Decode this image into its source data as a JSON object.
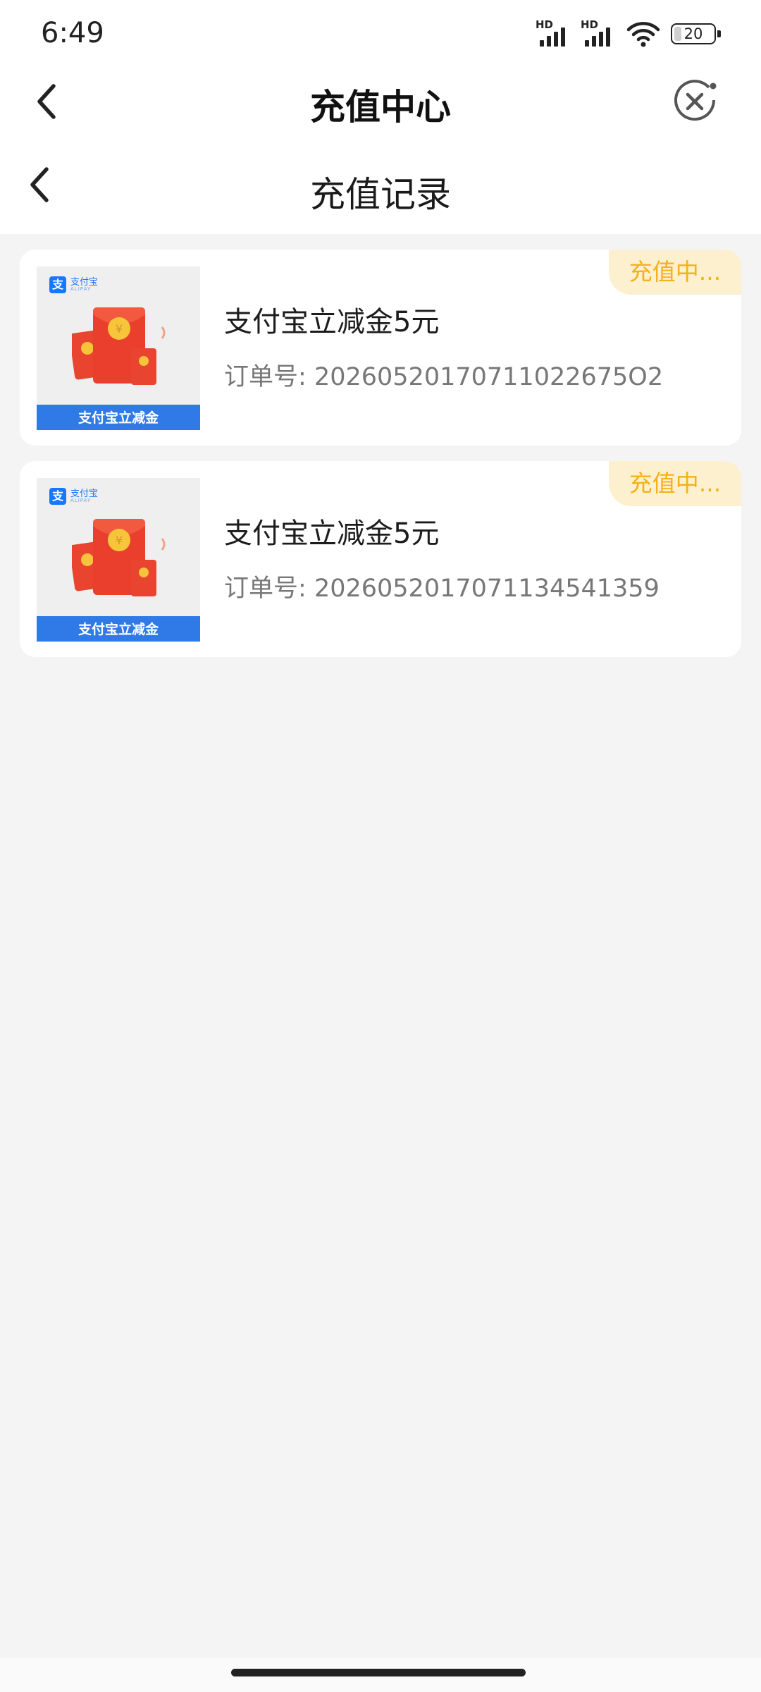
{
  "status_bar": {
    "time": "6:49",
    "signal_label": "HD",
    "battery_level": "20",
    "icons": [
      "hd-signal-icon",
      "hd-signal-icon",
      "wifi-icon",
      "battery-icon"
    ]
  },
  "header": {
    "title": "充值中心",
    "back_icon": "chevron-left-icon",
    "close_icon": "circle-close-icon"
  },
  "subheader": {
    "title": "充值记录",
    "back_icon": "chevron-left-icon"
  },
  "orders": [
    {
      "status": "充值中...",
      "product_name": "支付宝立减金5元",
      "order_label": "订单号:",
      "order_number": "20260520170711022675O2",
      "thumb": {
        "brand": "支付宝",
        "brand_sub": "ALIPAY",
        "banner": "支付宝立减金"
      }
    },
    {
      "status": "充值中...",
      "product_name": "支付宝立减金5元",
      "order_label": "订单号:",
      "order_number": "2026052017071134541359",
      "thumb": {
        "brand": "支付宝",
        "brand_sub": "ALIPAY",
        "banner": "支付宝立减金"
      }
    }
  ],
  "colors": {
    "status_tag_bg": "#fdf0cf",
    "status_tag_text": "#f3b21a",
    "brand_blue": "#1677ff",
    "page_bg": "#f4f4f5"
  }
}
